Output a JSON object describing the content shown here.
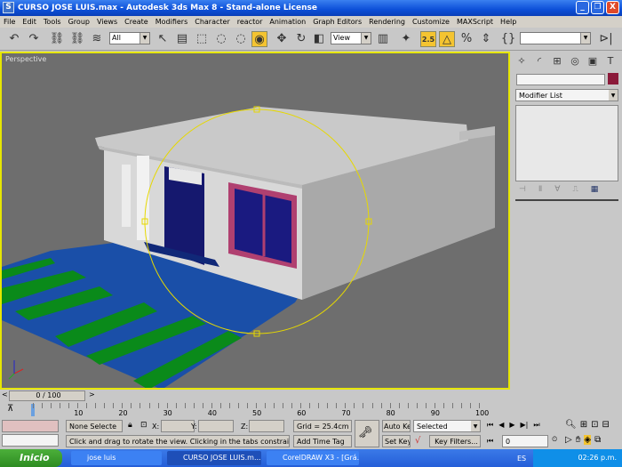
{
  "window": {
    "title": "CURSO JOSE LUIS.max - Autodesk 3ds Max 8  - Stand-alone License",
    "app_icon": "3ds-max-icon",
    "controls": [
      "_",
      "❐",
      "X"
    ]
  },
  "menu": [
    "File",
    "Edit",
    "Tools",
    "Group",
    "Views",
    "Create",
    "Modifiers",
    "Character",
    "reactor",
    "Animation",
    "Graph Editors",
    "Rendering",
    "Customize",
    "MAXScript",
    "Help"
  ],
  "toolbar": {
    "selection_filter": "All",
    "ref_coord": "View",
    "snap_angle_label": "2.5",
    "named_selection": ""
  },
  "viewport": {
    "label": "Perspective",
    "border_color": "#e6e600",
    "background": "#6e6e6e"
  },
  "command_panel": {
    "tabs": [
      "create",
      "modify",
      "hierarchy",
      "motion",
      "display",
      "utilities"
    ],
    "object_name": "",
    "object_color": "#8b1a3a",
    "modifier_list": "Modifier List"
  },
  "timeline": {
    "frame": "0 / 100",
    "ticks": [
      "0",
      "10",
      "20",
      "30",
      "40",
      "50",
      "60",
      "70",
      "80",
      "90",
      "100"
    ]
  },
  "status": {
    "selection": "None Selecte",
    "x_label": "X:",
    "y_label": "Y:",
    "z_label": "Z:",
    "x": "",
    "y": "",
    "z": "",
    "grid": "Grid = 25.4cm",
    "prompt": "Click and drag to rotate the view.  Clicking in the tabs constrains the rotation",
    "add_time_tag": "Add Time Tag",
    "auto_key": "Auto Key",
    "set_key": "Set Key",
    "key_mode": "Selected",
    "key_filters": "Key Filters...",
    "current_frame": "0"
  },
  "taskbar": {
    "start": "Inicio",
    "tasks": [
      {
        "label": "jose luis",
        "active": false
      },
      {
        "label": "CURSO JOSE LUIS.m...",
        "active": true
      },
      {
        "label": "CorelDRAW X3 - [Grá...",
        "active": false
      }
    ],
    "lang": "ES",
    "clock": "02:26 p.m."
  }
}
